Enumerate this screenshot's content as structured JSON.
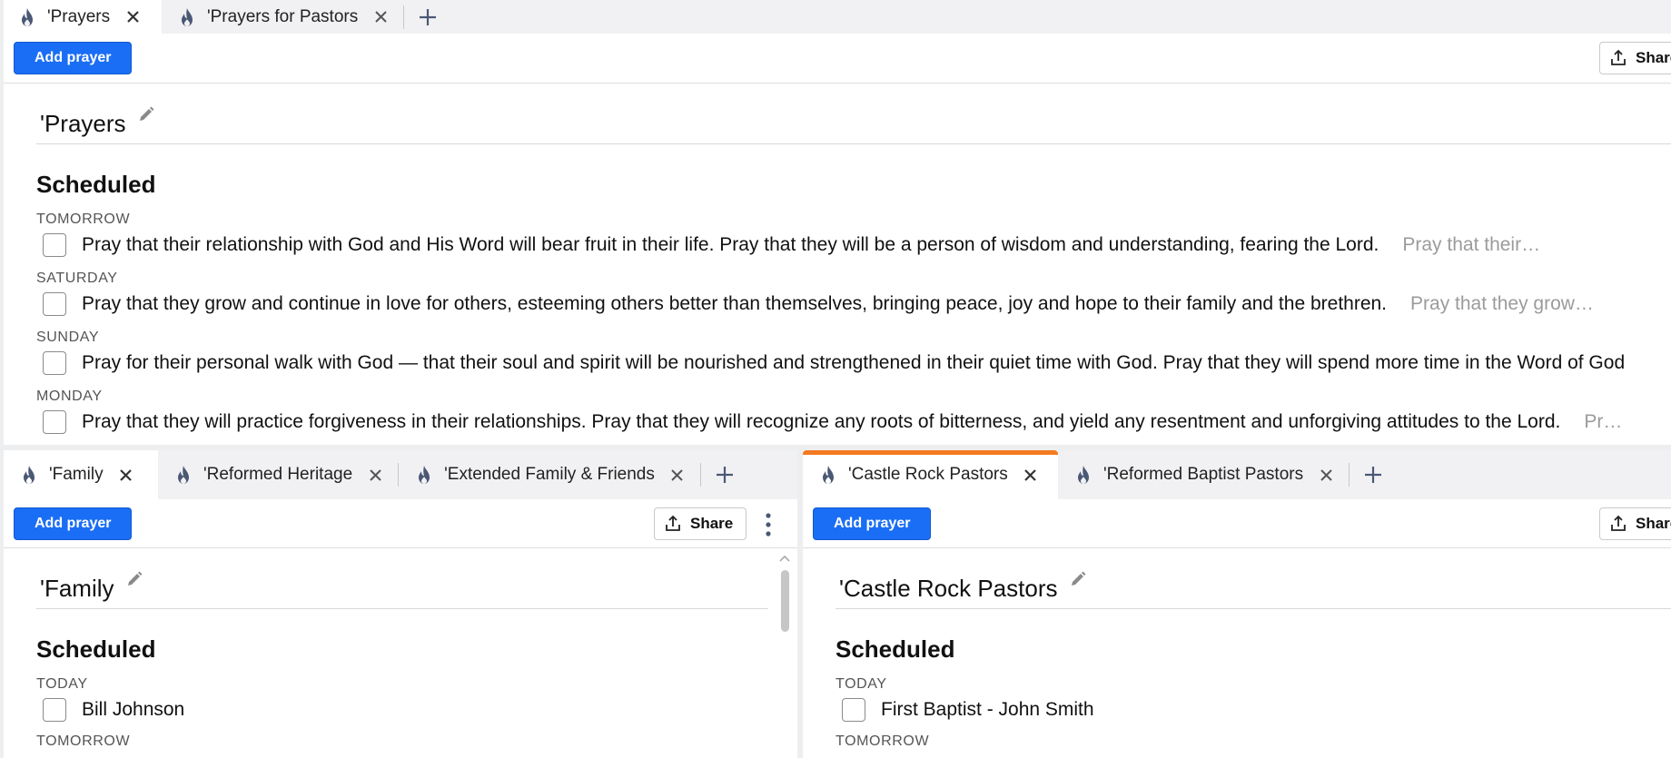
{
  "colors": {
    "accent": "#1a6ef5",
    "highlight_tab": "#f47a20"
  },
  "top_pane": {
    "tabs": [
      {
        "label": "'Prayers",
        "active": true
      },
      {
        "label": "'Prayers for Pastors",
        "active": false
      }
    ],
    "add_prayer_label": "Add prayer",
    "share_label": "Share",
    "list_title": "'Prayers",
    "section_title": "Scheduled",
    "days": [
      {
        "label": "TOMORROW",
        "text": "Pray that their relationship with God and His Word will bear fruit in their life. Pray that they will be a person of wisdom and understanding, fearing the Lord.",
        "ghost": "Pray that their…"
      },
      {
        "label": "SATURDAY",
        "text": "Pray that they grow and continue in love for others, esteeming others better than themselves, bringing peace, joy and hope to their family and the brethren.",
        "ghost": "Pray that they grow…"
      },
      {
        "label": "SUNDAY",
        "text": " Pray for their personal walk with God — that their soul and spirit will be nourished and strengthened in their quiet time with God. Pray that they will spend more time in the Word of God",
        "ghost": ""
      },
      {
        "label": "MONDAY",
        "text": "Pray that they will practice forgiveness in their relationships. Pray that they will recognize any roots of bitterness, and yield any resentment and unforgiving attitudes to the Lord.",
        "ghost": "Pr…"
      }
    ]
  },
  "left_pane": {
    "tabs": [
      {
        "label": "'Family",
        "active": true
      },
      {
        "label": "'Reformed Heritage",
        "active": false
      },
      {
        "label": "'Extended Family & Friends",
        "active": false
      }
    ],
    "add_prayer_label": "Add prayer",
    "share_label": "Share",
    "list_title": "'Family",
    "section_title": "Scheduled",
    "day1_label": "TODAY",
    "item1": "Bill Johnson",
    "day2_label": "TOMORROW"
  },
  "right_pane": {
    "tabs": [
      {
        "label": "'Castle Rock Pastors",
        "active": true
      },
      {
        "label": "'Reformed Baptist Pastors",
        "active": false
      }
    ],
    "add_prayer_label": "Add prayer",
    "share_label": "Share",
    "list_title": "'Castle Rock Pastors",
    "section_title": "Scheduled",
    "day1_label": "TODAY",
    "item1": "First Baptist - John Smith",
    "day2_label": "TOMORROW"
  }
}
